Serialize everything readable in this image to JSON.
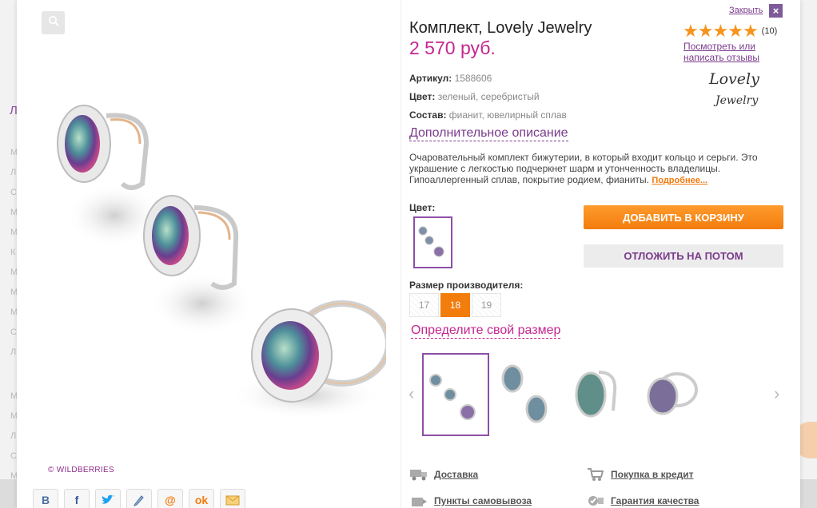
{
  "product": {
    "title": "Комплект, Lovely Jewelry",
    "price": "2 570 руб.",
    "article_label": "Артикул:",
    "article_value": "1588606",
    "color_label": "Цвет:",
    "color_value": "зеленый, серебристый",
    "composition_label": "Состав:",
    "composition_value": "фианит, ювелирный сплав",
    "more_description": "Дополнительное описание",
    "description": "Очаровательный комплект бижутерии, в который входит кольцо и серьги. Это украшение с легкостью подчеркнет шарм и утонченность владелицы. Гипоаллергенный сплав, покрытие родием, фианиты.",
    "details_link": "Подробнее..."
  },
  "header": {
    "close_label": "Закрыть",
    "close_icon": "×"
  },
  "rating": {
    "stars": 5,
    "max": 5,
    "count": "(10)",
    "reviews_link": "Посмотреть или написать отзывы"
  },
  "brand": {
    "logo_line1": "Lovely",
    "logo_line2": "Jewelry"
  },
  "options": {
    "color_heading": "Цвет:",
    "size_heading": "Размер производителя:",
    "sizes": [
      "17",
      "18",
      "19"
    ],
    "selected_size": "18",
    "find_size": "Определите свой размер"
  },
  "actions": {
    "add_to_cart": "ДОБАВИТЬ В КОРЗИНУ",
    "save_later": "ОТЛОЖИТЬ НА ПОТОМ"
  },
  "gallery": {
    "watermark": "© WILDBERRIES",
    "prev_arrow": "‹",
    "next_arrow": "›"
  },
  "social": [
    "B",
    "f",
    "twitter",
    "pen",
    "@",
    "ok",
    "mail"
  ],
  "info_links": {
    "delivery": "Доставка",
    "credit": "Покупка в кредит",
    "pickup": "Пункты самовывоза",
    "guarantee": "Гарантия качества"
  },
  "colors": {
    "accent_purple": "#7a3a8c",
    "price_pink": "#c5268f",
    "orange": "#f27c0c",
    "star": "#f7941d"
  },
  "background": {
    "letters": [
      "Л",
      "М",
      "Л",
      "С",
      "М",
      "М",
      "К",
      "М",
      "М",
      "М",
      "С",
      "Л",
      "М",
      "М",
      "Л",
      "С",
      "М",
      "С"
    ]
  }
}
